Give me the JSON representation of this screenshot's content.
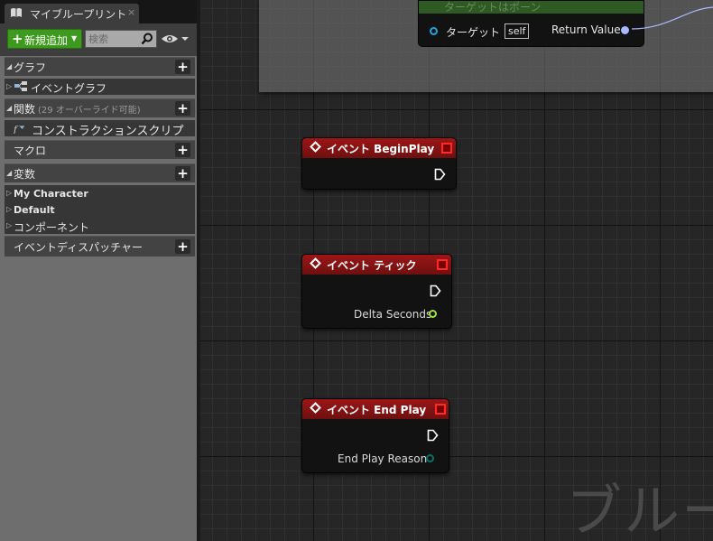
{
  "tab": {
    "title": "マイブループリント",
    "close": "×"
  },
  "toolbar": {
    "add_label": "新規追加",
    "search_placeholder": "検索"
  },
  "sections": {
    "graph": "グラフ",
    "functions": "関数",
    "functions_hint": "(29 オーバーライド可能)",
    "macros": "マクロ",
    "variables": "変数",
    "dispatchers": "イベントディスパッチャー"
  },
  "items": {
    "event_graph": "イベントグラフ",
    "construction_script": "コンストラクションスクリプ",
    "var_my_character": "My Character",
    "var_default": "Default",
    "var_components": "コンポーネント"
  },
  "top_node": {
    "subtitle": "ターゲットはポーン",
    "target_label": "ターゲット",
    "self_label": "self",
    "return_label": "Return Value"
  },
  "nodes": {
    "begin_play": {
      "title": "イベント BeginPlay"
    },
    "tick": {
      "title": "イベント ティック",
      "pin": "Delta Seconds"
    },
    "end_play": {
      "title": "イベント End Play",
      "pin": "End Play Reason"
    }
  },
  "watermark": "ブルー",
  "colors": {
    "add_button": "#3e9a1e",
    "event_header": "#9c1616",
    "float_pin": "#9fe236",
    "enum_pin": "#0b6e66",
    "object_pin": "#1fa6e8",
    "return_pin": "#a9b8ff"
  },
  "icons": {
    "tab": "blueprint-book-icon",
    "search": "magnifier-icon",
    "visibility": "eye-icon",
    "event_graph": "event-graph-icon",
    "construction": "function-icon"
  }
}
